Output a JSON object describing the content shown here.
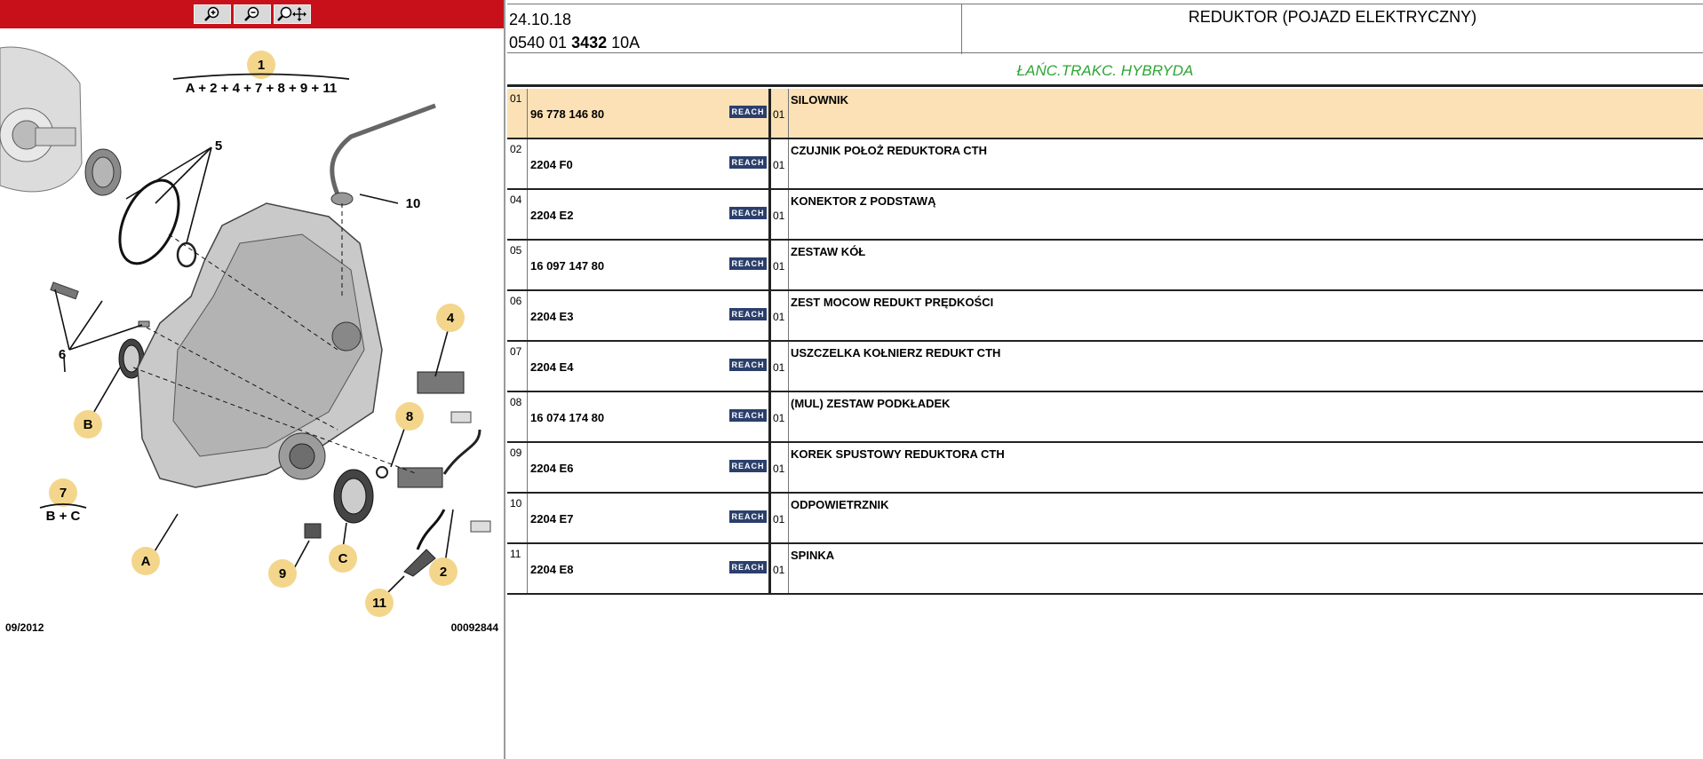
{
  "toolbar": {
    "buttons": [
      {
        "icon": "zoom-in-icon"
      },
      {
        "icon": "zoom-out-icon"
      },
      {
        "icon": "zoom-pan-icon"
      }
    ]
  },
  "diagram": {
    "formula1_num": "1",
    "formula1": "A + 2 + 4 + 7 + 8 + 9 + 11",
    "formula2_num": "7",
    "formula2": "B + C",
    "labels": {
      "l2": "2",
      "l4": "4",
      "l5": "5",
      "l6": "6",
      "l8": "8",
      "l9": "9",
      "l10": "10",
      "l11": "11",
      "lA": "A",
      "lB": "B",
      "lC": "C"
    },
    "date": "09/2012",
    "code": "00092844"
  },
  "header": {
    "date": "24.10.18",
    "ref_prefix": "0540 01 ",
    "ref_bold": "3432",
    "ref_suffix": " 10A",
    "title": "REDUKTOR (POJAZD ELEKTRYCZNY)"
  },
  "subtitle": "ŁAŃC.TRAKC. HYBRYDA",
  "reach_label": "REACH",
  "parts": [
    {
      "num": "01",
      "ref": "96 778 146 80",
      "qty": "01",
      "desc": "SILOWNIK"
    },
    {
      "num": "02",
      "ref": "2204 F0",
      "qty": "01",
      "desc": "CZUJNIK POŁOŻ REDUKTORA CTH"
    },
    {
      "num": "04",
      "ref": "2204 E2",
      "qty": "01",
      "desc": "KONEKTOR Z PODSTAWĄ"
    },
    {
      "num": "05",
      "ref": "16 097 147 80",
      "qty": "01",
      "desc": "ZESTAW KÓŁ"
    },
    {
      "num": "06",
      "ref": "2204 E3",
      "qty": "01",
      "desc": "ZEST MOCOW REDUKT PRĘDKOŚCI"
    },
    {
      "num": "07",
      "ref": "2204 E4",
      "qty": "01",
      "desc": "USZCZELKA KOŁNIERZ REDUKT CTH"
    },
    {
      "num": "08",
      "ref": "16 074 174 80",
      "qty": "01",
      "desc": "(MUL) ZESTAW PODKŁADEK"
    },
    {
      "num": "09",
      "ref": "2204 E6",
      "qty": "01",
      "desc": "KOREK SPUSTOWY REDUKTORA CTH"
    },
    {
      "num": "10",
      "ref": "2204 E7",
      "qty": "01",
      "desc": "ODPOWIETRZNIK"
    },
    {
      "num": "11",
      "ref": "2204 E8",
      "qty": "01",
      "desc": "SPINKA"
    }
  ]
}
